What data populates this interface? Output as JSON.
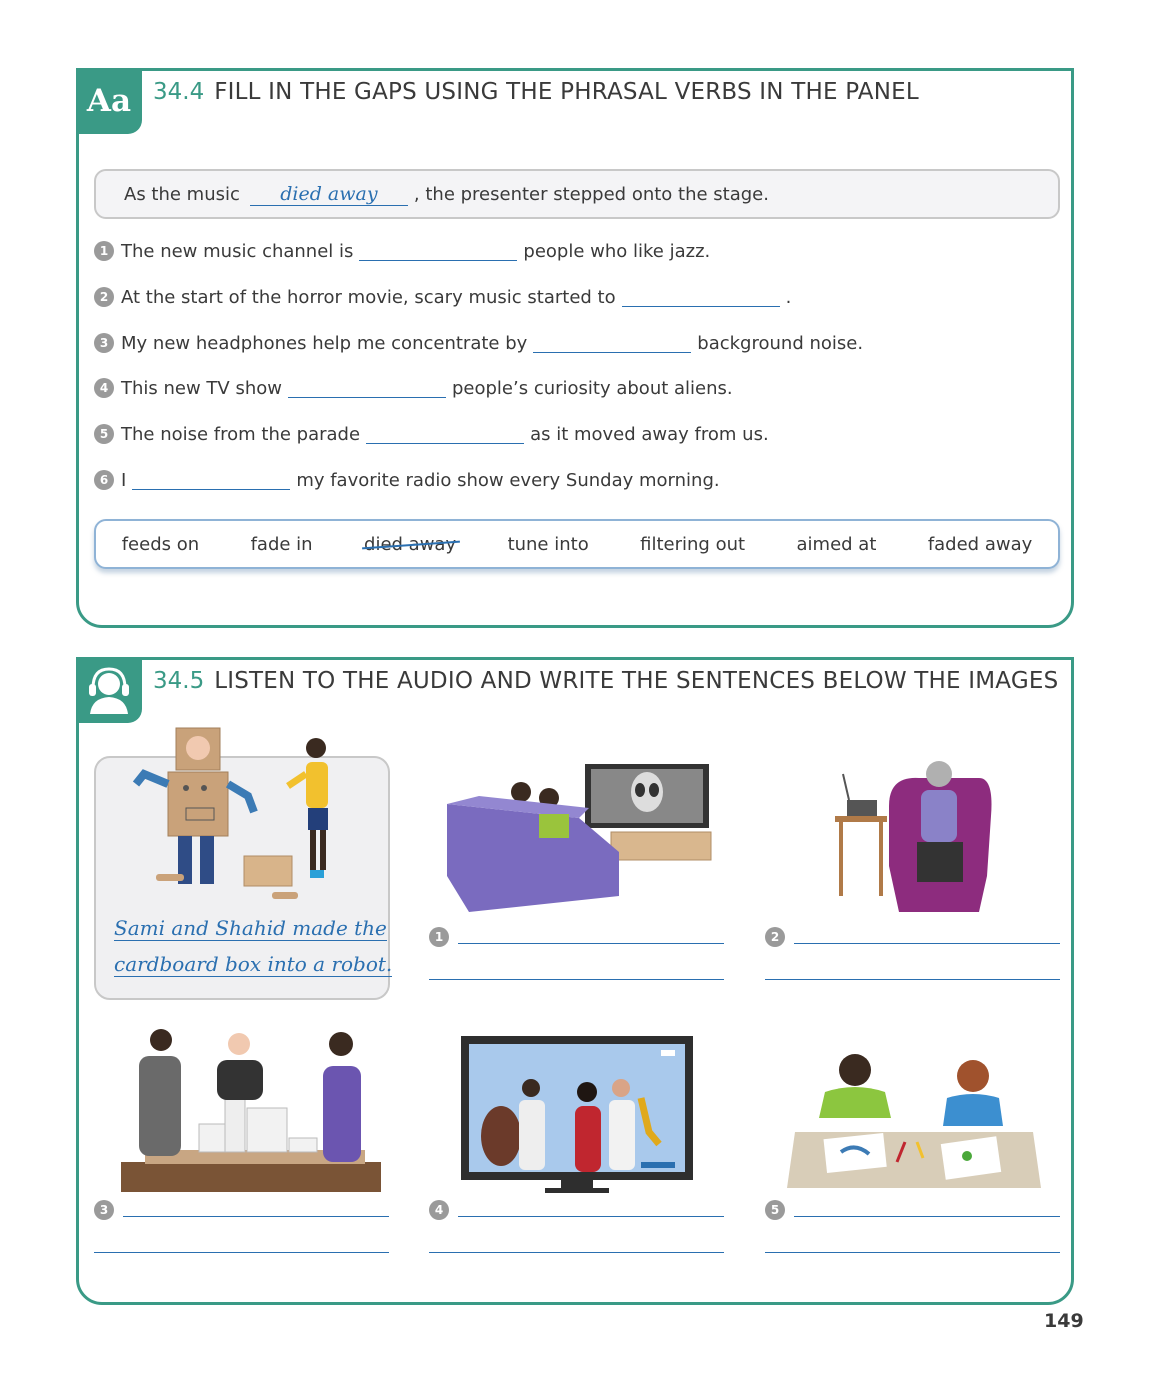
{
  "exercise1": {
    "badge": "Aa",
    "number": "34.4",
    "title": "FILL IN THE GAPS USING THE PHRASAL VERBS IN THE PANEL",
    "example": {
      "before": "As the music",
      "answer": "died away",
      "after": ", the presenter stepped onto the stage."
    },
    "sentences": [
      {
        "n": "1",
        "before": "The new music channel is",
        "after": "people who like jazz."
      },
      {
        "n": "2",
        "before": "At the start of the horror movie, scary music started to",
        "after": "."
      },
      {
        "n": "3",
        "before": "My new headphones help me concentrate by",
        "after": "background noise."
      },
      {
        "n": "4",
        "before": "This new TV show",
        "after": "people’s curiosity about aliens."
      },
      {
        "n": "5",
        "before": "The noise from the parade",
        "after": "as it moved away from us."
      },
      {
        "n": "6",
        "before": "I",
        "after": "my favorite radio show every Sunday morning."
      }
    ],
    "word_bank": [
      "feeds on",
      "fade in",
      "died away",
      "tune into",
      "filtering out",
      "aimed at",
      "faded away"
    ],
    "word_bank_struck": "died away"
  },
  "exercise2": {
    "number": "34.5",
    "title": "LISTEN TO THE AUDIO AND WRITE THE SENTENCES BELOW THE IMAGES",
    "icon": "headphones-person-icon",
    "example_lines": [
      "Sami and Shahid made the",
      "cardboard box into a robot."
    ],
    "items": [
      "1",
      "2",
      "3",
      "4",
      "5"
    ]
  },
  "page_number": "149",
  "colors": {
    "teal": "#3a9a86",
    "answer_blue": "#2a6fb0",
    "grey_circle": "#9a9a9a"
  }
}
